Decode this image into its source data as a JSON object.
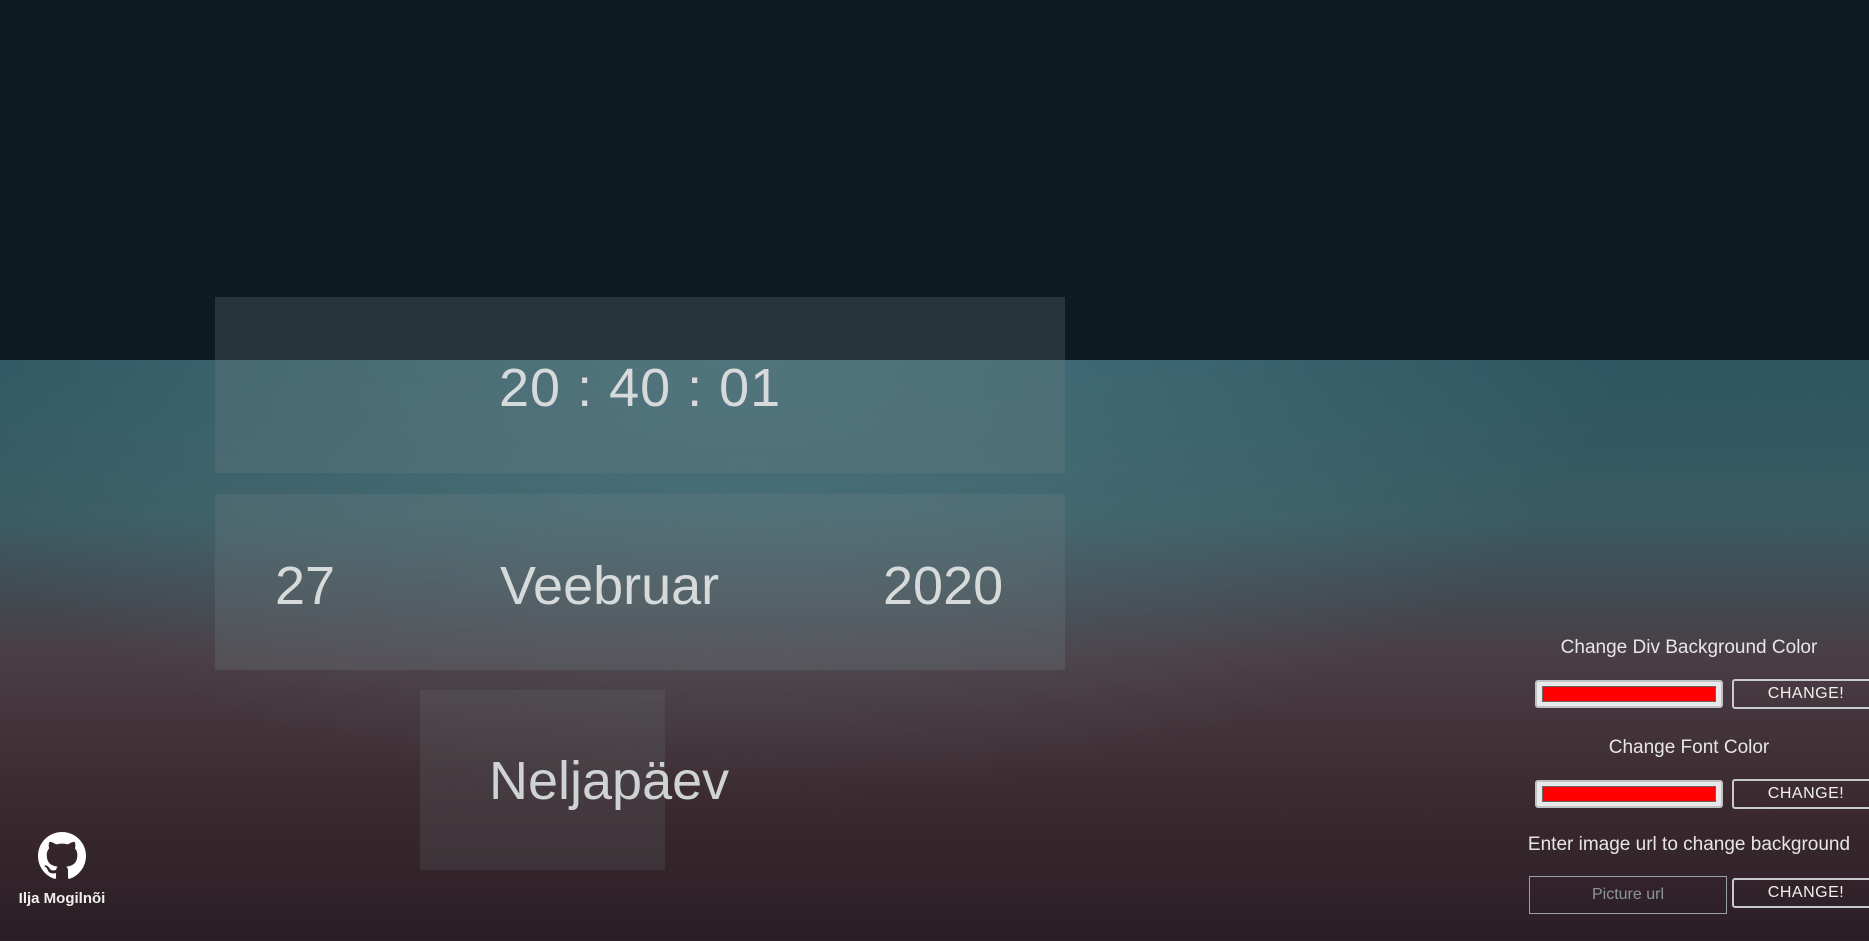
{
  "clock": {
    "time": "20 : 40 : 01",
    "day": "27",
    "month": "Veebruar",
    "year": "2020",
    "weekday": "Neljapäev"
  },
  "controls": {
    "div_bg_label": "Change Div Background Color",
    "div_bg_value": "#ff0000",
    "div_bg_button": "CHANGE!",
    "font_color_label": "Change Font Color",
    "font_color_value": "#ff0000",
    "font_color_button": "CHANGE!",
    "bg_image_label": "Enter image url to change background",
    "bg_image_placeholder": "Picture url",
    "bg_image_button": "CHANGE!"
  },
  "footer": {
    "author": "Ilja Mogilnõi",
    "icon": "github-icon"
  },
  "colors": {
    "accent_swatch": "#ff0000",
    "text": "#d6dadb"
  }
}
